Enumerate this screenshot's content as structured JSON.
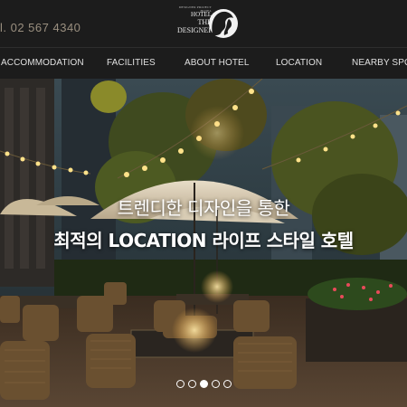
{
  "header": {
    "phone": "l. 02 567 4340",
    "logo": {
      "line_small": "DESIGNER PROJECT HOTEL",
      "line1": "HOTEL",
      "line2": "THE",
      "line3": "DESIGNERS",
      "icon": "face-silhouette-icon"
    }
  },
  "nav": {
    "items": [
      {
        "label": "ACCOMMODATION"
      },
      {
        "label": "FACILITIES"
      },
      {
        "label": "ABOUT HOTEL"
      },
      {
        "label": "LOCATION"
      },
      {
        "label": "NEARBY SPOT"
      }
    ]
  },
  "hero": {
    "headline_line1": "트렌디한 디자인을 통한",
    "headline_line2": "최적의 LOCATION 라이프 스타일 호텔",
    "slides_total": 5,
    "active_slide": 3
  },
  "colors": {
    "background": "#1c1c1c",
    "phone_text": "#9a8f7f",
    "nav_text": "#e0e0e0"
  }
}
